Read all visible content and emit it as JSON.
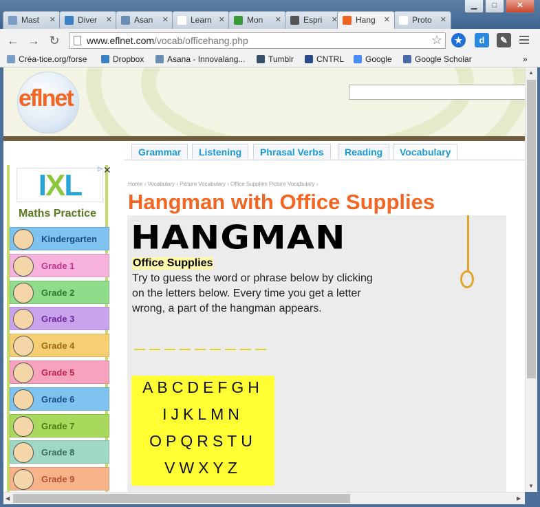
{
  "browser": {
    "tabs": [
      {
        "label": "Mast",
        "color": "#7a9cc6"
      },
      {
        "label": "Diver",
        "color": "#3b82c4"
      },
      {
        "label": "Asan",
        "color": "#6a8fb3"
      },
      {
        "label": "Learn",
        "color": "#ffffff"
      },
      {
        "label": "Mon",
        "color": "#3a9a3a"
      },
      {
        "label": "Espri",
        "color": "#555555"
      },
      {
        "label": "Hang",
        "color": "#f26522"
      },
      {
        "label": "Proto",
        "color": "#ffffff"
      }
    ],
    "active_tab_index": 6,
    "url_domain": "www.eflnet.com",
    "url_path": "/vocab/officehang.php",
    "bookmarks": [
      {
        "label": "Créa-tice.org/forse",
        "color": "#7a9cc6"
      },
      {
        "label": "Dropbox",
        "color": "#3b82c4"
      },
      {
        "label": "Asana - Innovalang...",
        "color": "#6a8fb3"
      },
      {
        "label": "Tumblr",
        "color": "#3a4f6a"
      },
      {
        "label": "CNTRL",
        "color": "#2a4a8a"
      },
      {
        "label": "Google",
        "color": "#4a8af4"
      },
      {
        "label": "Google Scholar",
        "color": "#4a6aa8"
      }
    ],
    "bookmarks_overflow": "»"
  },
  "site": {
    "logo": "eflnet",
    "nav_tabs": [
      "Grammar",
      "Listening",
      "Phrasal Verbs",
      "Reading",
      "Vocabulary"
    ],
    "active_nav": 4
  },
  "ad": {
    "brand": "IXL",
    "title": "Maths Practice",
    "grades": [
      {
        "label": "Kindergarten",
        "bg": "#7ec3ef",
        "fg": "#1a4a8a"
      },
      {
        "label": "Grade 1",
        "bg": "#f7b3dd",
        "fg": "#c2338a"
      },
      {
        "label": "Grade 2",
        "bg": "#8fdc8a",
        "fg": "#2a7a2a"
      },
      {
        "label": "Grade 3",
        "bg": "#c9a3ec",
        "fg": "#6a2a9a"
      },
      {
        "label": "Grade 4",
        "bg": "#f5cf72",
        "fg": "#9a6a10"
      },
      {
        "label": "Grade 5",
        "bg": "#f7a3bd",
        "fg": "#c2234a"
      },
      {
        "label": "Grade 6",
        "bg": "#7ec3ef",
        "fg": "#1a4a8a"
      },
      {
        "label": "Grade 7",
        "bg": "#a9d95c",
        "fg": "#4a7a10"
      },
      {
        "label": "Grade 8",
        "bg": "#9fd8c5",
        "fg": "#3a6a5a"
      },
      {
        "label": "Grade 9",
        "bg": "#f9b389",
        "fg": "#b0502a"
      }
    ]
  },
  "content": {
    "breadcrumb": "Home › Vocabulary › Picture Vocabulary › Office Supplies Picture Vocabulary ›",
    "title": "Hangman with Office Supplies",
    "game": {
      "heading": "HANGMAN",
      "category": "Office Supplies",
      "instructions": "Try to guess the word or phrase below by clicking on the letters below. Every time you get a letter wrong, a part of the hangman appears.",
      "blank_count": 9,
      "letter_rows": [
        [
          "A",
          "B",
          "C",
          "D",
          "E",
          "F",
          "G",
          "H"
        ],
        [
          "I",
          "J",
          "K",
          "L",
          "M",
          "N"
        ],
        [
          "O",
          "P",
          "Q",
          "R",
          "S",
          "T",
          "U"
        ],
        [
          "V",
          "W",
          "X",
          "Y",
          "Z"
        ]
      ]
    }
  }
}
